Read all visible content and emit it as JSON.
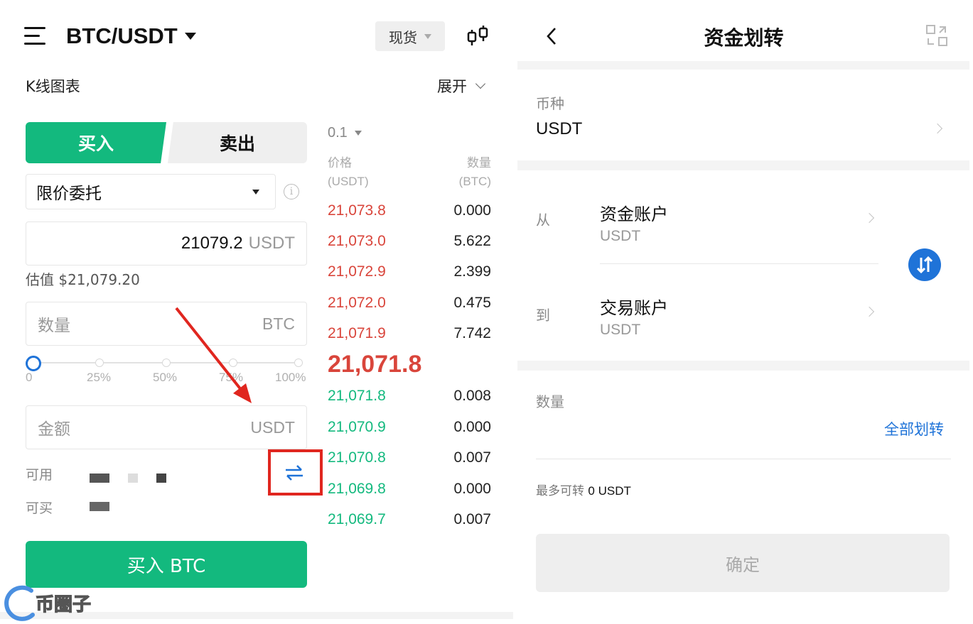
{
  "left": {
    "pair": "BTC/USDT",
    "market_type": "现货",
    "kline_label": "K线图表",
    "expand_label": "展开",
    "tabs": {
      "buy": "买入",
      "sell": "卖出"
    },
    "order_type": "限价委托",
    "price_input": {
      "value": "21079.2",
      "unit": "USDT"
    },
    "estimate": "估值 $21,079.20",
    "quantity_input": {
      "placeholder": "数量",
      "unit": "BTC"
    },
    "slider": {
      "percent": 0,
      "labels": [
        "0",
        "25%",
        "50%",
        "75%",
        "100%"
      ]
    },
    "amount_input": {
      "placeholder": "金额",
      "unit": "USDT"
    },
    "available_label": "可用",
    "can_buy_label": "可买",
    "buy_button": "买入 BTC",
    "orderbook": {
      "depth": "0.1",
      "price_header": "价格",
      "price_unit": "(USDT)",
      "qty_header": "数量",
      "qty_unit": "(BTC)",
      "asks": [
        {
          "price": "21,073.8",
          "qty": "0.000"
        },
        {
          "price": "21,073.0",
          "qty": "5.622"
        },
        {
          "price": "21,072.9",
          "qty": "2.399"
        },
        {
          "price": "21,072.0",
          "qty": "0.475"
        },
        {
          "price": "21,071.9",
          "qty": "7.742"
        }
      ],
      "last_price": "21,071.8",
      "bids": [
        {
          "price": "21,071.8",
          "qty": "0.008"
        },
        {
          "price": "21,070.9",
          "qty": "0.000"
        },
        {
          "price": "21,070.8",
          "qty": "0.007"
        },
        {
          "price": "21,069.8",
          "qty": "0.000"
        },
        {
          "price": "21,069.7",
          "qty": "0.007"
        }
      ]
    },
    "watermark": "币圈子"
  },
  "right": {
    "title": "资金划转",
    "currency_label": "币种",
    "currency_value": "USDT",
    "from_label": "从",
    "from_account": "资金账户",
    "from_unit": "USDT",
    "to_label": "到",
    "to_account": "交易账户",
    "to_unit": "USDT",
    "amount_label": "数量",
    "transfer_all": "全部划转",
    "max_label": "最多可转",
    "max_value": "0 USDT",
    "confirm": "确定"
  },
  "colors": {
    "green": "#13b97e",
    "red": "#d9453b",
    "blue": "#1f73d8",
    "annotation_red": "#e0261f"
  }
}
